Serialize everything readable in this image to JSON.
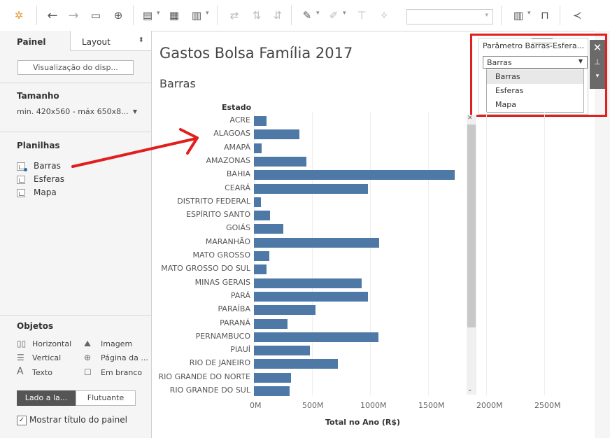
{
  "toolbar": {
    "icons": [
      "tableau-logo-icon",
      "back-icon",
      "forward-icon",
      "save-icon",
      "add-datasource-icon",
      "new-worksheet-icon",
      "duplicate-sheet-icon",
      "clear-sheet-icon",
      "swap-icon",
      "sort-asc-icon",
      "sort-desc-icon",
      "highlight-icon",
      "annotate-icon",
      "text-icon",
      "pin-icon",
      "show-me-icon",
      "presentation-icon",
      "share-icon"
    ]
  },
  "left_panel": {
    "tabs": {
      "painel": "Painel",
      "layout": "Layout"
    },
    "device_preview_button": "Visualização do disp...",
    "size_section": {
      "title": "Tamanho",
      "value": "min. 420x560 - máx 650x8..."
    },
    "sheets_section": {
      "title": "Planilhas",
      "items": [
        "Barras",
        "Esferas",
        "Mapa"
      ]
    },
    "objects_section": {
      "title": "Objetos",
      "items": [
        {
          "label": "Horizontal",
          "icon": "horizontal-container-icon"
        },
        {
          "label": "Imagem",
          "icon": "image-icon"
        },
        {
          "label": "Vertical",
          "icon": "vertical-container-icon"
        },
        {
          "label": "Página da ...",
          "icon": "web-page-icon"
        },
        {
          "label": "Texto",
          "icon": "text-icon"
        },
        {
          "label": "Em branco",
          "icon": "blank-icon"
        }
      ]
    },
    "layout_buttons": {
      "tiled": "Lado a la...",
      "floating": "Flutuante"
    },
    "show_title_checkbox": {
      "label": "Mostrar título do painel",
      "checked": true,
      "check_mark": "✓"
    }
  },
  "dashboard": {
    "title": "Gastos Bolsa Família 2017",
    "sheet_title": "Barras"
  },
  "chart_data": {
    "type": "bar",
    "orientation": "horizontal",
    "row_header": "Estado",
    "xlabel": "Total no Ano (R$)",
    "xlim": [
      0,
      3000
    ],
    "x_ticks": [
      "0M",
      "500M",
      "1000M",
      "1500M",
      "2000M",
      "2500M"
    ],
    "bar_color": "#4e79a7",
    "categories": [
      "ACRE",
      "ALAGOAS",
      "AMAPÁ",
      "AMAZONAS",
      "BAHIA",
      "CEARÁ",
      "DISTRITO FEDERAL",
      "ESPÍRITO SANTO",
      "GOIÁS",
      "MARANHÃO",
      "MATO GROSSO",
      "MATO GROSSO DO SUL",
      "MINAS GERAIS",
      "PARÁ",
      "PARAÍBA",
      "PARANÁ",
      "PERNAMBUCO",
      "PIAUÍ",
      "RIO DE JANEIRO",
      "RIO GRANDE DO NORTE",
      "RIO GRANDE DO SUL"
    ],
    "values": [
      110,
      390,
      65,
      450,
      1730,
      980,
      60,
      140,
      250,
      1080,
      130,
      110,
      930,
      980,
      530,
      290,
      1070,
      480,
      720,
      320,
      310
    ]
  },
  "parameter": {
    "title": "Parâmetro Barras-Esfera...",
    "selected": "Barras",
    "options": [
      "Barras",
      "Esferas",
      "Mapa"
    ],
    "close_icon": "✕",
    "pin_icon": "⊥",
    "menu_icon": "▾"
  },
  "annotation": {
    "highlight_color": "#e0201e"
  }
}
